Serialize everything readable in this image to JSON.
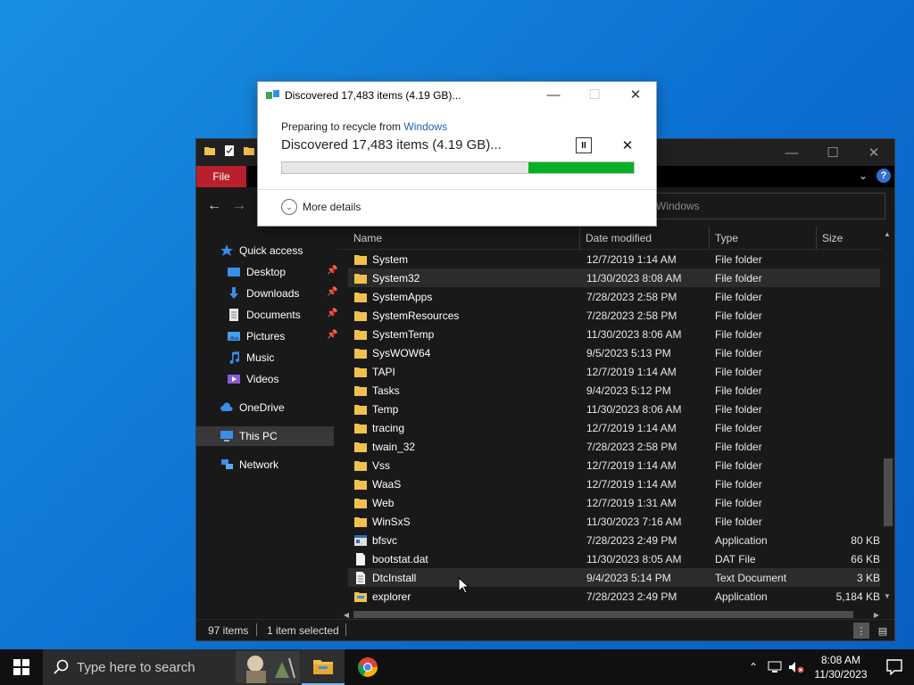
{
  "dialog": {
    "title": "Discovered 17,483 items (4.19 GB)...",
    "preparing_prefix": "Preparing to recycle from",
    "preparing_source": "Windows",
    "heading": "Discovered 17,483 items (4.19 GB)...",
    "progress_percent": 30,
    "more_details": "More details"
  },
  "explorer": {
    "ribbon_file_tab": "File",
    "search_placeholder": "Windows",
    "columns": {
      "name": "Name",
      "date": "Date modified",
      "type": "Type",
      "size": "Size"
    },
    "nav": {
      "quick_access": "Quick access",
      "desktop": "Desktop",
      "downloads": "Downloads",
      "documents": "Documents",
      "pictures": "Pictures",
      "music": "Music",
      "videos": "Videos",
      "onedrive": "OneDrive",
      "this_pc": "This PC",
      "network": "Network"
    },
    "files": [
      {
        "name": "System",
        "date": "12/7/2019 1:14 AM",
        "type": "File folder",
        "size": "",
        "icon": "folder-icon"
      },
      {
        "name": "System32",
        "date": "11/30/2023 8:08 AM",
        "type": "File folder",
        "size": "",
        "icon": "folder-icon"
      },
      {
        "name": "SystemApps",
        "date": "7/28/2023 2:58 PM",
        "type": "File folder",
        "size": "",
        "icon": "folder-icon"
      },
      {
        "name": "SystemResources",
        "date": "7/28/2023 2:58 PM",
        "type": "File folder",
        "size": "",
        "icon": "folder-icon"
      },
      {
        "name": "SystemTemp",
        "date": "11/30/2023 8:06 AM",
        "type": "File folder",
        "size": "",
        "icon": "folder-icon"
      },
      {
        "name": "SysWOW64",
        "date": "9/5/2023 5:13 PM",
        "type": "File folder",
        "size": "",
        "icon": "folder-icon"
      },
      {
        "name": "TAPI",
        "date": "12/7/2019 1:14 AM",
        "type": "File folder",
        "size": "",
        "icon": "folder-icon"
      },
      {
        "name": "Tasks",
        "date": "9/4/2023 5:12 PM",
        "type": "File folder",
        "size": "",
        "icon": "folder-icon"
      },
      {
        "name": "Temp",
        "date": "11/30/2023 8:06 AM",
        "type": "File folder",
        "size": "",
        "icon": "folder-icon"
      },
      {
        "name": "tracing",
        "date": "12/7/2019 1:14 AM",
        "type": "File folder",
        "size": "",
        "icon": "folder-icon"
      },
      {
        "name": "twain_32",
        "date": "7/28/2023 2:58 PM",
        "type": "File folder",
        "size": "",
        "icon": "folder-icon"
      },
      {
        "name": "Vss",
        "date": "12/7/2019 1:14 AM",
        "type": "File folder",
        "size": "",
        "icon": "folder-icon"
      },
      {
        "name": "WaaS",
        "date": "12/7/2019 1:14 AM",
        "type": "File folder",
        "size": "",
        "icon": "folder-icon"
      },
      {
        "name": "Web",
        "date": "12/7/2019 1:31 AM",
        "type": "File folder",
        "size": "",
        "icon": "folder-icon"
      },
      {
        "name": "WinSxS",
        "date": "11/30/2023 7:16 AM",
        "type": "File folder",
        "size": "",
        "icon": "folder-icon"
      },
      {
        "name": "bfsvc",
        "date": "7/28/2023 2:49 PM",
        "type": "Application",
        "size": "80 KB",
        "icon": "application-icon"
      },
      {
        "name": "bootstat.dat",
        "date": "11/30/2023 8:05 AM",
        "type": "DAT File",
        "size": "66 KB",
        "icon": "file-icon"
      },
      {
        "name": "DtcInstall",
        "date": "9/4/2023 5:14 PM",
        "type": "Text Document",
        "size": "3 KB",
        "icon": "text-document-icon"
      },
      {
        "name": "explorer",
        "date": "7/28/2023 2:49 PM",
        "type": "Application",
        "size": "5,184 KB",
        "icon": "explorer-app-icon"
      }
    ],
    "status": {
      "item_count": "97 items",
      "selection": "1 item selected"
    }
  },
  "taskbar": {
    "search_placeholder": "Type here to search",
    "clock_time": "8:08 AM",
    "clock_date": "11/30/2023"
  }
}
